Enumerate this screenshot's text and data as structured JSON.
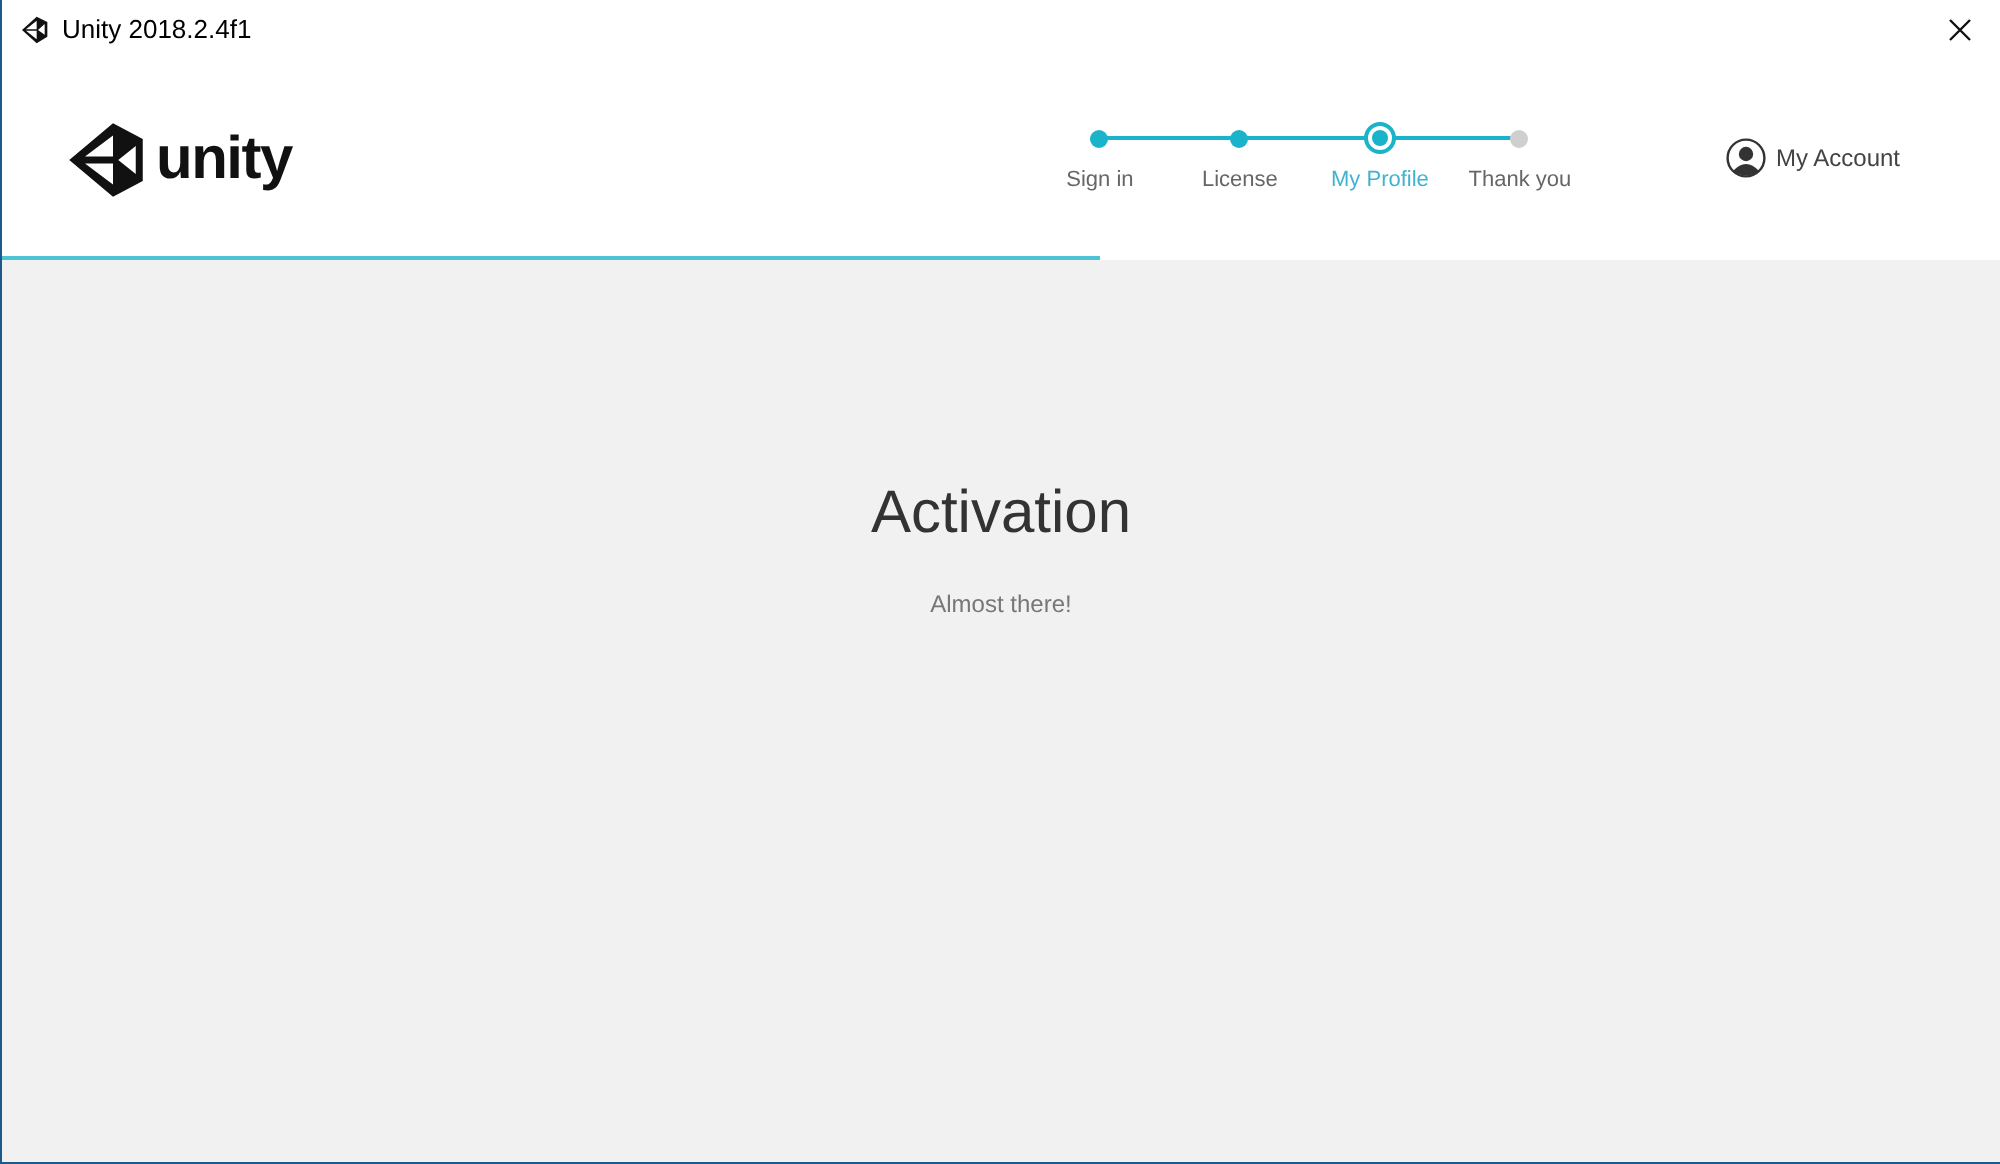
{
  "window": {
    "title": "Unity 2018.2.4f1"
  },
  "logo": {
    "text": "unity"
  },
  "steps": [
    {
      "label": "Sign in",
      "completed": true,
      "selected": false
    },
    {
      "label": "License",
      "completed": true,
      "selected": false
    },
    {
      "label": "My Profile",
      "selected": true
    },
    {
      "label": "Thank you",
      "completed": false,
      "selected": false
    }
  ],
  "account": {
    "label": "My Account"
  },
  "progress": {
    "level": 0.55
  },
  "main": {
    "title": "Activation",
    "subtitle": "Almost there!"
  }
}
